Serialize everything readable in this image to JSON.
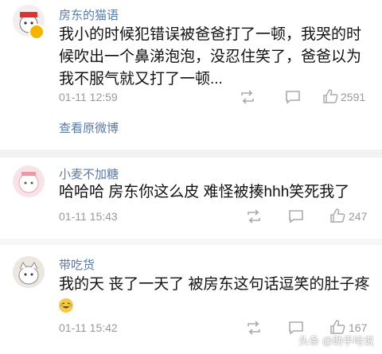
{
  "comments": [
    {
      "username": "房东的猫语",
      "text": "我小的时候犯错误被爸爸打了一顿，我哭的时候吹出一个鼻涕泡泡，没忍住笑了，爸爸以为我不服气就又打了一顿...",
      "time": "01-11 12:59",
      "likes": "2591",
      "link": "查看原微博"
    },
    {
      "username": "小麦不加糖",
      "text": "哈哈哈 房东你这么皮 难怪被揍hhh笑死我了",
      "time": "01-11 15:43",
      "likes": "247"
    },
    {
      "username": "带吃货",
      "text": "我的天 丧了一天了 被房东这句话逗笑的肚子疼",
      "time": "01-11 15:42",
      "likes": "167"
    }
  ],
  "watermark": "头条 @助手哈说",
  "icons": {
    "repost": "repost-icon",
    "comment": "comment-icon",
    "like": "thumbs-up-icon",
    "vip": "vip-badge-icon",
    "emoji": "laughing-emoji-icon"
  },
  "colors": {
    "username": "#5a7aa8",
    "meta": "#999999",
    "text": "#111111",
    "divider": "#f2f2f2"
  }
}
